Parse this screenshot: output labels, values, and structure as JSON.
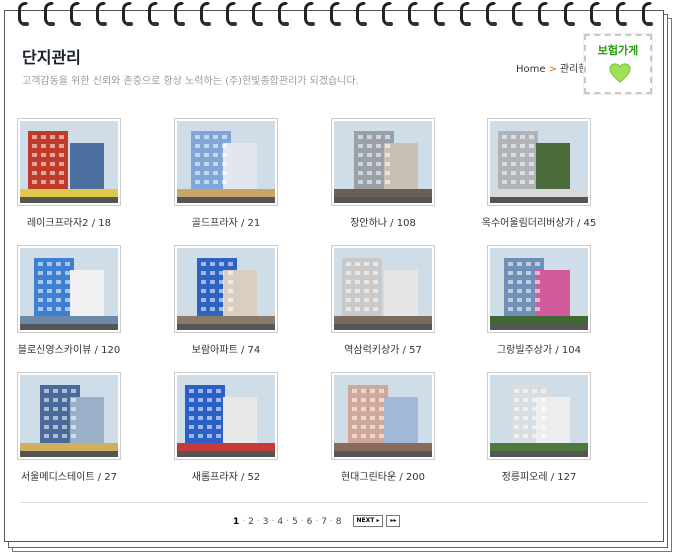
{
  "header": {
    "title": "단지관리",
    "subtitle": "고객감동을 위한 신뢰와 존중으로 항상 노력하는 (주)한빛종합관리가 되겠습니다.",
    "breadcrumb": {
      "home": "Home",
      "separator": ">",
      "current": "관리현"
    }
  },
  "stamp": {
    "text": "보험가게",
    "color": "#2a9a10",
    "icon": "heart-icon"
  },
  "complexes": [
    {
      "label": "레이크프라자2 / 18",
      "palette": [
        "#c23a2c",
        "#4b6f9e",
        "#e0c84a"
      ]
    },
    {
      "label": "골드프라자 / 21",
      "palette": [
        "#7fa6d6",
        "#e2e6ee",
        "#c9a56a"
      ]
    },
    {
      "label": "장안하나 / 108",
      "palette": [
        "#9aa0a8",
        "#c8c0b4",
        "#6b5d52"
      ]
    },
    {
      "label": "옥수어울림더리버상가 / 45",
      "palette": [
        "#b0b4b8",
        "#4c6b3a",
        "#d9d9d9"
      ]
    },
    {
      "label": "블로신영스카이뷰 / 120",
      "palette": [
        "#3f7fd2",
        "#f0f0f0",
        "#6a8aa8"
      ]
    },
    {
      "label": "보람아파트 / 74",
      "palette": [
        "#2e63c2",
        "#d9cfc0",
        "#8a7a68"
      ]
    },
    {
      "label": "역삼럭키상가 / 57",
      "palette": [
        "#c9c9c9",
        "#e6e6e6",
        "#7a6a60"
      ]
    },
    {
      "label": "그랑빌주상가 / 104",
      "palette": [
        "#6f8fb6",
        "#d05a9a",
        "#3c6a32"
      ]
    },
    {
      "label": "서울메디스테이트 / 27",
      "palette": [
        "#4a6a9a",
        "#9ab0c8",
        "#d0b060"
      ]
    },
    {
      "label": "새롬프라자 / 52",
      "palette": [
        "#2b5fc8",
        "#e8e8e8",
        "#c83a3a"
      ]
    },
    {
      "label": "현대그린타운 / 200",
      "palette": [
        "#d0a89a",
        "#a2b8d8",
        "#8a6a5a"
      ]
    },
    {
      "label": "정릉피오레 / 127",
      "palette": [
        "#d8dde2",
        "#eeeeee",
        "#4c7a3c"
      ]
    }
  ],
  "pagination": {
    "pages": [
      "1",
      "2",
      "3",
      "4",
      "5",
      "6",
      "7",
      "8"
    ],
    "current": "1",
    "next_label": "NEXT ▸",
    "last_label": "▸▸"
  }
}
